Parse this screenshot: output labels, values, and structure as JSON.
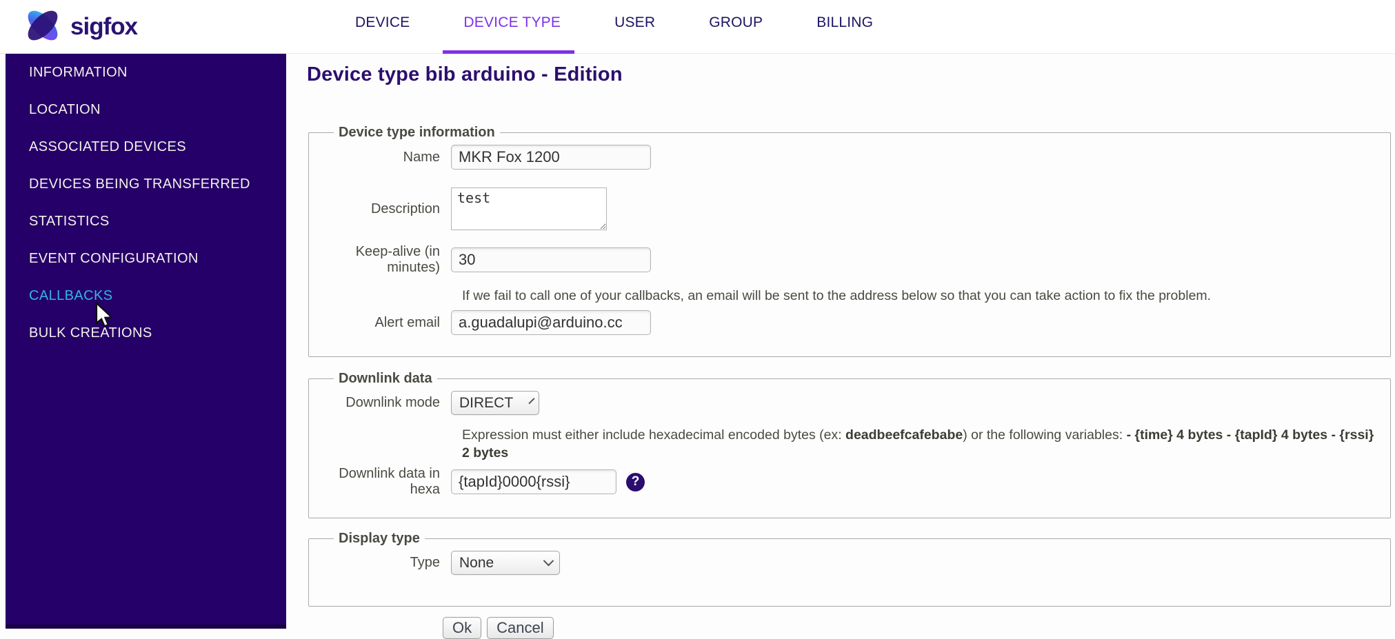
{
  "brand": {
    "name": "sigfox"
  },
  "nav": {
    "active_index": 1,
    "items": [
      {
        "label": "DEVICE"
      },
      {
        "label": "DEVICE TYPE"
      },
      {
        "label": "USER"
      },
      {
        "label": "GROUP"
      },
      {
        "label": "BILLING"
      }
    ]
  },
  "sidebar": {
    "active_label": "CALLBACKS",
    "items": [
      {
        "label": "INFORMATION"
      },
      {
        "label": "LOCATION"
      },
      {
        "label": "ASSOCIATED DEVICES"
      },
      {
        "label": "DEVICES BEING TRANSFERRED"
      },
      {
        "label": "STATISTICS"
      },
      {
        "label": "EVENT CONFIGURATION"
      },
      {
        "label": "CALLBACKS"
      },
      {
        "label": "BULK CREATIONS"
      }
    ]
  },
  "page": {
    "title": "Device type bib arduino - Edition"
  },
  "device_info": {
    "legend": "Device type information",
    "name_label": "Name",
    "name_value": "MKR Fox 1200",
    "description_label": "Description",
    "description_value": "test",
    "keepalive_label": "Keep-alive (in minutes)",
    "keepalive_value": "30",
    "alert_help": "If we fail to call one of your callbacks, an email will be sent to the address below so that you can take action to fix the problem.",
    "alert_email_label": "Alert email",
    "alert_email_value": "a.guadalupi@arduino.cc"
  },
  "downlink": {
    "legend": "Downlink data",
    "mode_label": "Downlink mode",
    "mode_value": "DIRECT",
    "expr_text_1": "Expression must either include hexadecimal encoded bytes (ex: ",
    "expr_bold_1": "deadbeefcafebabe",
    "expr_text_2": ") or the following variables: ",
    "expr_bold_2": "- {time} 4 bytes - {tapId} 4 bytes - {rssi} 2 bytes",
    "hexa_label": "Downlink data in hexa",
    "hexa_value": "{tapId}0000{rssi}",
    "help_icon_glyph": "?"
  },
  "display_type": {
    "legend": "Display type",
    "type_label": "Type",
    "type_value": "None"
  },
  "actions": {
    "ok_label": "Ok",
    "cancel_label": "Cancel"
  },
  "colors": {
    "sidebar_bg": "#250068",
    "sidebar_bottom_strip": "#190145",
    "sidebar_active_text": "#35b4e5",
    "nav_text": "#1c1462",
    "nav_active": "#7d30e8",
    "heading_text": "#2c0e6e",
    "help_icon_bg": "#2a0d6e",
    "brand_text": "#2b1272"
  }
}
